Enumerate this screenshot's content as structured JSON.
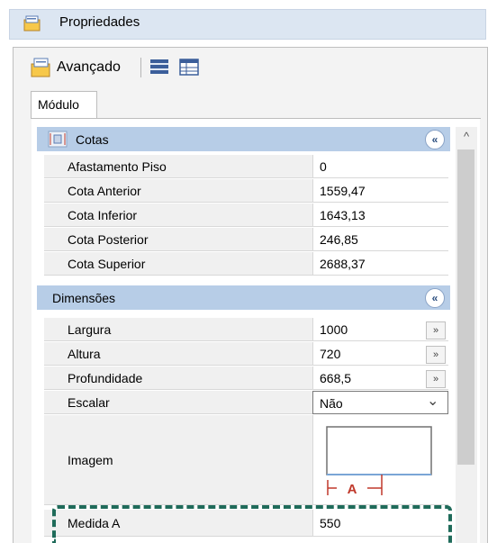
{
  "title": "Propriedades",
  "toolbar": {
    "mode_label": "Avançado"
  },
  "tab": {
    "label": "Módulo"
  },
  "cotas": {
    "label": "Cotas",
    "rows": [
      {
        "label": "Afastamento Piso",
        "value": "0"
      },
      {
        "label": "Cota Anterior",
        "value": "1559,47"
      },
      {
        "label": "Cota Inferior",
        "value": "1643,13"
      },
      {
        "label": "Cota Posterior",
        "value": "246,85"
      },
      {
        "label": "Cota Superior",
        "value": "2688,37"
      }
    ]
  },
  "dimensoes": {
    "label": "Dimensões",
    "rows": [
      {
        "label": "Largura",
        "value": "1000"
      },
      {
        "label": "Altura",
        "value": "720"
      },
      {
        "label": "Profundidade",
        "value": "668,5"
      },
      {
        "label": "Escalar",
        "value": "Não"
      },
      {
        "label": "Imagem",
        "value": ""
      },
      {
        "label": "Medida A",
        "value": "550"
      }
    ],
    "preview_marker": "A"
  },
  "glyphs": {
    "collapse": "«",
    "expand": "»",
    "dropdown": "⌄",
    "scroll_up": "^"
  },
  "colors": {
    "category_bg": "#b7cde7",
    "highlight_dash": "#1f6b5a",
    "dimension_red": "#c0392b"
  }
}
